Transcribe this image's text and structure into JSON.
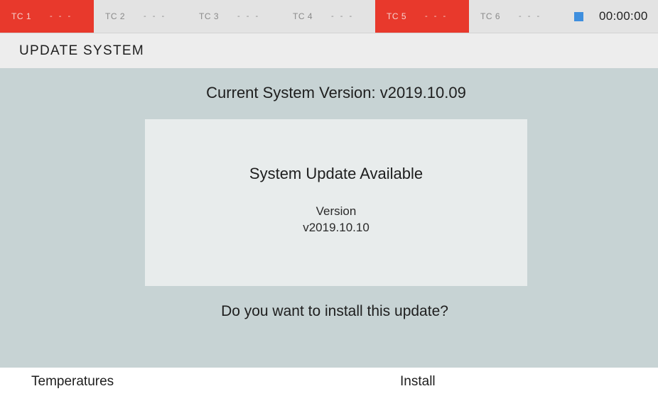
{
  "thermocouples": [
    {
      "label": "TC 1",
      "value": "- - -",
      "alarm": true
    },
    {
      "label": "TC 2",
      "value": "- - -",
      "alarm": false
    },
    {
      "label": "TC 3",
      "value": "- - -",
      "alarm": false
    },
    {
      "label": "TC 4",
      "value": "- - -",
      "alarm": false
    },
    {
      "label": "TC 5",
      "value": "- - -",
      "alarm": true
    },
    {
      "label": "TC 6",
      "value": "- - -",
      "alarm": false
    }
  ],
  "status": {
    "indicator_color": "#3f8fde",
    "timer": "00:00:00"
  },
  "header": {
    "title": "UPDATE SYSTEM"
  },
  "main": {
    "current_version": "Current System Version: v2019.10.09",
    "update_card": {
      "title": "System Update Available",
      "version_label": "Version",
      "version_value": "v2019.10.10"
    },
    "prompt": "Do you want to install this update?"
  },
  "footer": {
    "left_label": "Temperatures",
    "right_label": "Install"
  },
  "colors": {
    "alarm": "#e8392c",
    "panel": "#c7d3d4",
    "card": "#e8ecec"
  }
}
